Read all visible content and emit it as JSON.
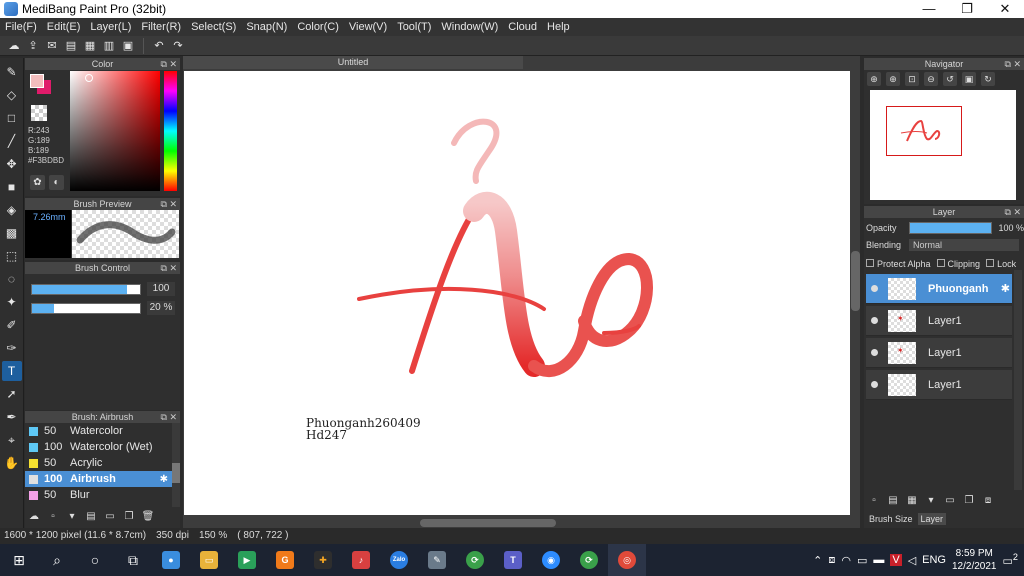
{
  "window": {
    "title": "MediBang Paint Pro (32bit)",
    "minimize": "—",
    "maximize": "❐",
    "close": "✕"
  },
  "menu": [
    "File(F)",
    "Edit(E)",
    "Layer(L)",
    "Filter(R)",
    "Select(S)",
    "Snap(N)",
    "Color(C)",
    "View(V)",
    "Tool(T)",
    "Window(W)",
    "Cloud",
    "Help"
  ],
  "color_panel": {
    "title": "Color",
    "r": "R:243",
    "g": "G:189",
    "b": "B:189",
    "hex": "#F3BDBD",
    "main_color": "#f3bdbd"
  },
  "brush_preview": {
    "title": "Brush Preview",
    "size": "7.26mm"
  },
  "brush_control": {
    "title": "Brush Control",
    "size_value": "100",
    "opacity_value": "20 %",
    "size_fraction": 0.88,
    "opacity_fraction": 0.2
  },
  "brush_list": {
    "title": "Brush: Airbrush",
    "items": [
      {
        "num": "50",
        "name": "Watercolor",
        "color": "#5ec8f5"
      },
      {
        "num": "100",
        "name": "Watercolor (Wet)",
        "color": "#5ec8f5"
      },
      {
        "num": "50",
        "name": "Acrylic",
        "color": "#f5e030"
      },
      {
        "num": "100",
        "name": "Airbrush",
        "color": "#e0e0e0"
      },
      {
        "num": "50",
        "name": "Blur",
        "color": "#f5a0e8"
      }
    ]
  },
  "canvas": {
    "tab": "Untitled",
    "signature_line1": "Phuonganh260409",
    "signature_line2": "Hd247"
  },
  "navigator": {
    "title": "Navigator"
  },
  "layer_panel": {
    "title": "Layer",
    "opacity_label": "Opacity",
    "opacity_value": "100 %",
    "blending_label": "Blending",
    "blending_value": "Normal",
    "protect_alpha": "Protect Alpha",
    "clipping": "Clipping",
    "lock": "Lock",
    "layers": [
      "Phuonganh",
      "Layer1",
      "Layer1",
      "Layer1"
    ],
    "tab_brush_size": "Brush Size",
    "tab_layer": "Layer"
  },
  "status": {
    "dimensions": "1600 * 1200 pixel  (11.6 * 8.7cm)",
    "dpi": "350 dpi",
    "zoom": "150 %",
    "coords": "( 807, 722 )"
  },
  "taskbar": {
    "lang": "ENG",
    "time": "8:59 PM",
    "date": "12/2/2021",
    "notifications": "2",
    "zalo": "Zalo"
  }
}
